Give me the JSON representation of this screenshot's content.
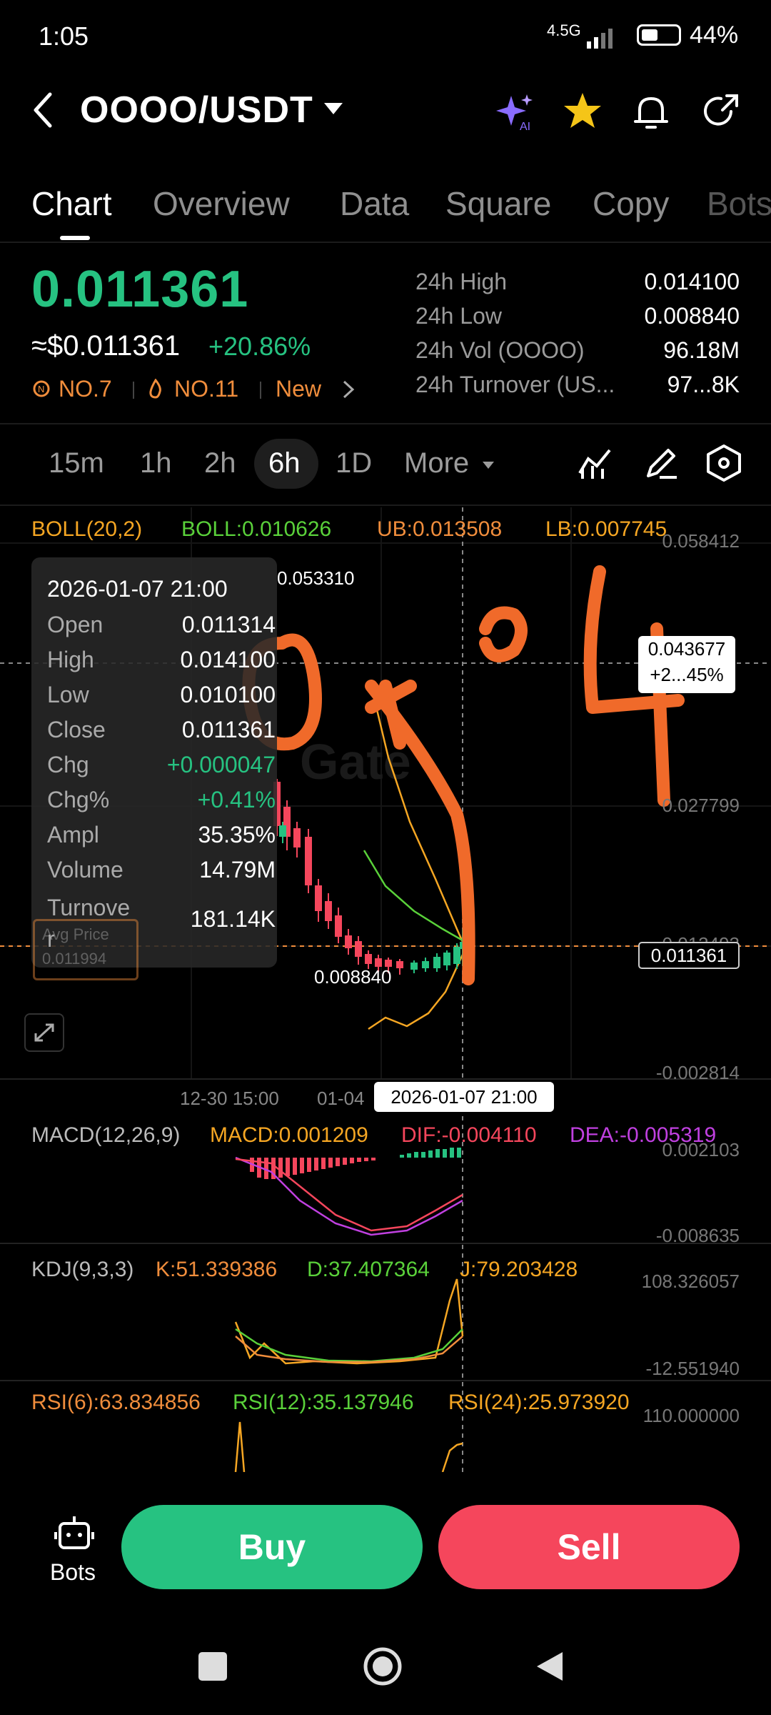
{
  "status": {
    "time": "1:05",
    "network": "4.5G",
    "battery": "44%"
  },
  "header": {
    "pair": "OOOO/USDT",
    "icons": [
      "back-arrow-icon",
      "ai-sparkle-icon",
      "star-icon",
      "bell-icon",
      "share-icon"
    ],
    "ai_badge": "AI"
  },
  "tabs": [
    "Chart",
    "Overview",
    "Data",
    "Square",
    "Copy",
    "Bots"
  ],
  "price": {
    "last": "0.011361",
    "fiat": "≈$0.011361",
    "change": "+20.86%",
    "rank1": "NO.7",
    "rank2": "NO.11",
    "new_label": "New",
    "stats": [
      {
        "label": "24h  High",
        "value": "0.014100"
      },
      {
        "label": "24h  Low",
        "value": "0.008840"
      },
      {
        "label": "24h  Vol (OOOO)",
        "value": "96.18M"
      },
      {
        "label": "24h  Turnover (US...",
        "value": "97...8K"
      }
    ]
  },
  "intervals": {
    "items": [
      "15m",
      "1h",
      "2h",
      "6h",
      "1D"
    ],
    "active": "6h",
    "more": "More"
  },
  "boll": {
    "name": "BOLL(20,2)",
    "boll": "BOLL:0.010626",
    "ub": "UB:0.013508",
    "lb": "LB:0.007745"
  },
  "y_axis": [
    "0.058412",
    "0.027799",
    "0.013493",
    "-0.002814"
  ],
  "chart_labels": {
    "high": "0.053310",
    "low": "0.008840",
    "cross_price": "0.043677",
    "cross_pct": "+2...45%",
    "last_tag": "0.011361",
    "avg_label": "Avg Price",
    "avg_value": "0.011994"
  },
  "x_axis": {
    "d1": "12-30 15:00",
    "d2": "01-04",
    "selected": "2026-01-07 21:00"
  },
  "tooltip": {
    "date": "2026-01-07 21:00",
    "rows": [
      {
        "label": "Open",
        "value": "0.011314"
      },
      {
        "label": "High",
        "value": "0.014100"
      },
      {
        "label": "Low",
        "value": "0.010100"
      },
      {
        "label": "Close",
        "value": "0.011361"
      },
      {
        "label": "Chg",
        "value": "+0.000047"
      },
      {
        "label": "Chg%",
        "value": "+0.41%"
      },
      {
        "label": "Ampl",
        "value": "35.35%"
      },
      {
        "label": "Volume",
        "value": "14.79M"
      },
      {
        "label": "Turnove\nr",
        "value": "181.14K"
      }
    ]
  },
  "macd": {
    "name": "MACD(12,26,9)",
    "macd": "MACD:0.001209",
    "dif": "DIF:-0.004110",
    "dea": "DEA:-0.005319",
    "top": "0.002103",
    "bottom": "-0.008635"
  },
  "kdj": {
    "name": "KDJ(9,3,3)",
    "k": "K:51.339386",
    "d": "D:37.407364",
    "j": "J:79.203428",
    "top": "108.326057",
    "bottom": "-12.551940"
  },
  "rsi": {
    "name": "RSI(6):63.834856",
    "rsi12": "RSI(12):35.137946",
    "rsi24": "RSI(24):25.973920",
    "top": "110.000000"
  },
  "bottom_bar": {
    "bots": "Bots",
    "buy": "Buy",
    "sell": "Sell"
  },
  "annotation": "0x"
}
